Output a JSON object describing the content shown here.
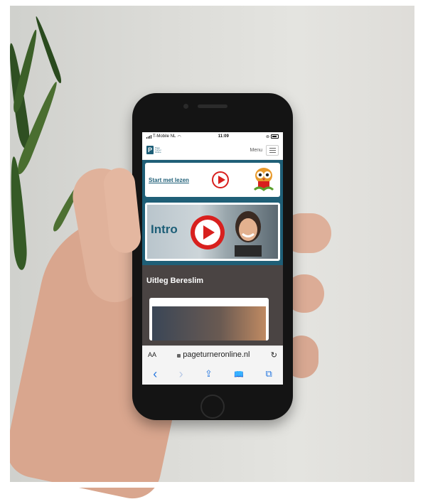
{
  "status": {
    "carrier": "T-Mobile NL",
    "time": "11:09"
  },
  "nav": {
    "logo_letter": "P",
    "logo_text": "Page Turner Online",
    "menu_label": "Menu"
  },
  "banner": {
    "start_label": "Start met lezen"
  },
  "intro": {
    "label": "Intro"
  },
  "section": {
    "title": "Uitleg Bereslim"
  },
  "browser": {
    "aa": "AA",
    "url": "pageturneronline.nl",
    "reload": "↻"
  },
  "toolbar": {
    "back": "‹",
    "forward": "›",
    "share": "⇪",
    "bookmarks": "📖",
    "tabs": "⧉"
  },
  "colors": {
    "teal": "#1f5f77",
    "red": "#d8201e",
    "dark": "#4a4443",
    "ios_blue": "#2a7ae0"
  }
}
